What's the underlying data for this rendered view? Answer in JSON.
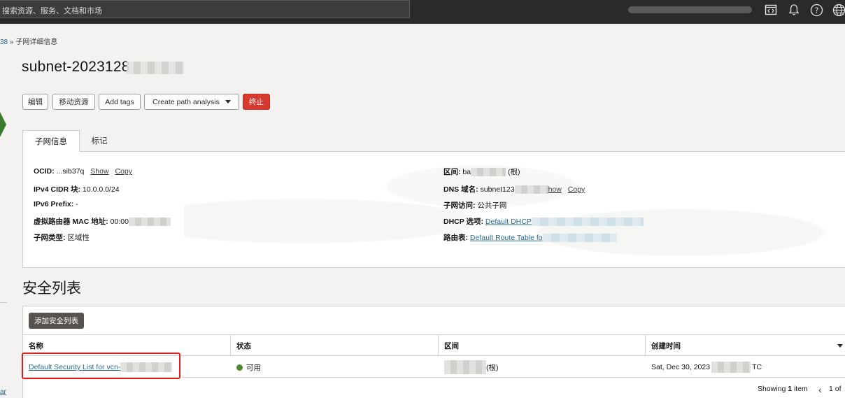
{
  "topbar": {
    "search_placeholder": "搜索资源、服务、文档和市场",
    "icons": [
      "code-console-icon",
      "bell-icon",
      "help-icon",
      "globe-icon"
    ]
  },
  "breadcrumb": {
    "prev": "38",
    "sep": "»",
    "current": "子网详细信息"
  },
  "title": "subnet-2023128",
  "actions": {
    "edit": "编辑",
    "move": "移动资源",
    "add_tags": "Add tags",
    "path_analysis": "Create path analysis",
    "terminate": "终止"
  },
  "tabs": {
    "info": "子网信息",
    "tags": "标记"
  },
  "info": {
    "ocid_label": "OCID:",
    "ocid_value": "...sib37q",
    "show": "Show",
    "copy": "Copy",
    "ipv4_label": "IPv4 CIDR 块:",
    "ipv4_value": "10.0.0.0/24",
    "ipv6_label": "IPv6 Prefix:",
    "ipv6_value": "-",
    "mac_label": "虚拟路由器 MAC 地址:",
    "mac_value": "00:00",
    "type_label": "子网类型:",
    "type_value": "区域性",
    "compartment_label": "区间:",
    "compartment_value": "ba",
    "compartment_suffix": "(根)",
    "dns_label": "DNS 域名:",
    "dns_value": "subnet123",
    "dns_show": "how",
    "dns_copy": "Copy",
    "access_label": "子网访问:",
    "access_value": "公共子网",
    "dhcp_label": "DHCP 选项:",
    "dhcp_value": "Default DHCP",
    "route_label": "路由表:",
    "route_value": "Default Route Table fo"
  },
  "security": {
    "heading": "安全列表",
    "add_button": "添加安全列表",
    "columns": [
      "名称",
      "状态",
      "区间",
      "创建时间"
    ],
    "rows": [
      {
        "name": "Default Security List for vcn-",
        "status": "可用",
        "compartment": "(根)",
        "created": "Sat, Dec 30, 2023",
        "created_suffix": "TC"
      }
    ],
    "showing": "Showing",
    "count": "1",
    "item": "item",
    "pager": "1 of"
  },
  "left": {
    "link": "ar"
  },
  "colors": {
    "topbar": "#2b2a28",
    "danger": "#d7392f",
    "link": "#2a6b93",
    "status_ok": "#4c8a2e",
    "highlight": "#e01b1b"
  }
}
